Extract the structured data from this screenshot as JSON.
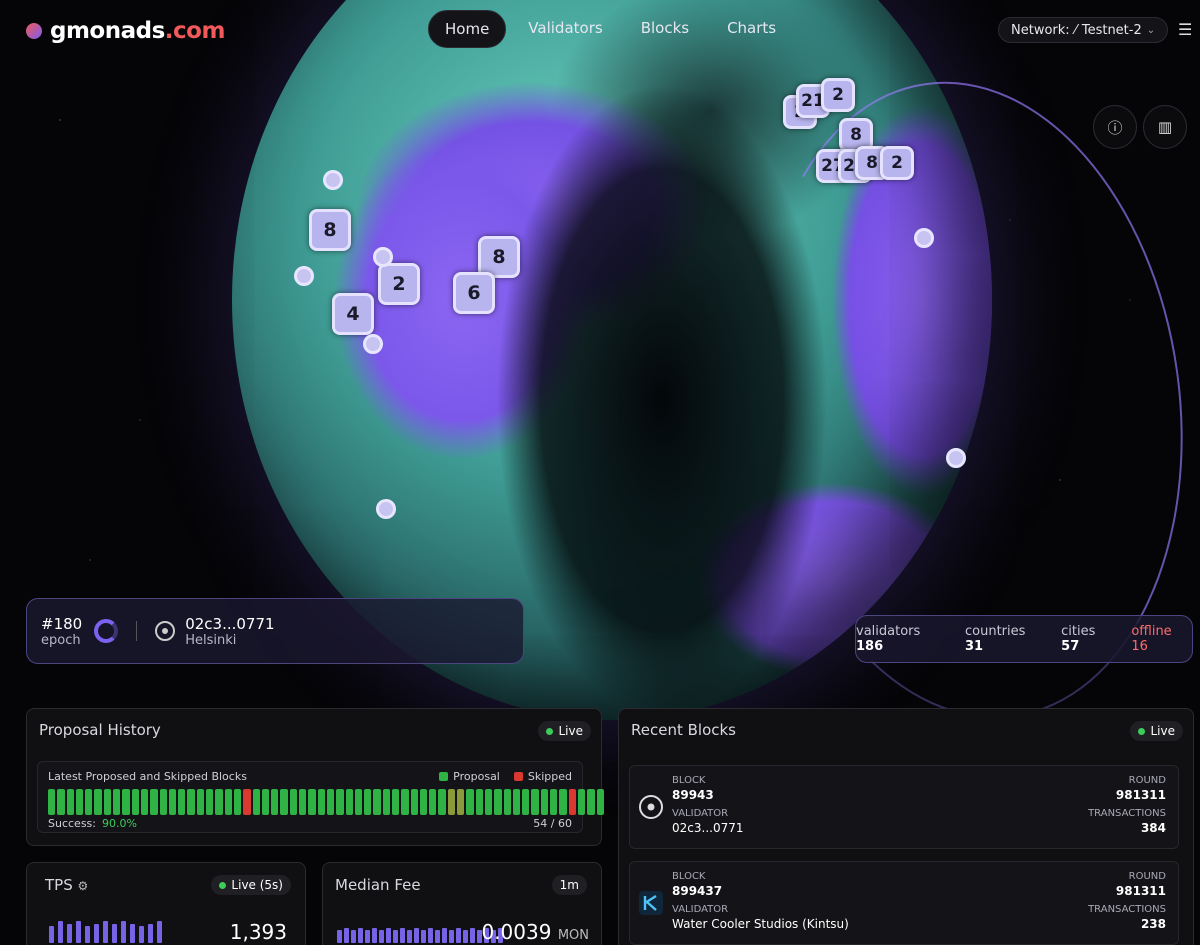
{
  "brand": {
    "name": "gmonads",
    "tld": ".com"
  },
  "nav": [
    "Home",
    "Validators",
    "Blocks",
    "Charts"
  ],
  "network": {
    "label": "Network:",
    "value": "Testnet-2"
  },
  "map_markers": [
    "2",
    "21",
    "2",
    "8",
    "27",
    "27",
    "8",
    "2",
    "8",
    "8",
    "2",
    "6",
    "4"
  ],
  "epoch": {
    "number": "#180",
    "label": "epoch",
    "validator": "02c3...0771",
    "city": "Helsinki"
  },
  "stats": {
    "validators_label": "validators",
    "validators": "186",
    "countries_label": "countries",
    "countries": "31",
    "cities_label": "cities",
    "cities": "57",
    "offline_label": "offline",
    "offline": "16"
  },
  "proposal_history": {
    "title": "Proposal History",
    "live": "Live",
    "subtitle": "Latest Proposed and Skipped Blocks",
    "legend_proposal": "Proposal",
    "legend_skipped": "Skipped",
    "success_label": "Success:",
    "success_value": "90.0%",
    "count": "54 / 60",
    "colors": {
      "proposal": "#2fb344",
      "skipped": "#d9392f",
      "partial": "#8a9a3a"
    },
    "blocks": [
      "P",
      "P",
      "P",
      "P",
      "P",
      "P",
      "P",
      "P",
      "P",
      "P",
      "P",
      "P",
      "P",
      "P",
      "P",
      "P",
      "P",
      "P",
      "P",
      "P",
      "P",
      "S",
      "P",
      "P",
      "P",
      "P",
      "P",
      "P",
      "P",
      "P",
      "P",
      "P",
      "P",
      "P",
      "P",
      "P",
      "P",
      "P",
      "P",
      "P",
      "P",
      "P",
      "P",
      "S",
      "S",
      "P",
      "P",
      "P",
      "P",
      "P",
      "P",
      "P",
      "P",
      "P",
      "P",
      "P",
      "S",
      "P",
      "P",
      "P"
    ]
  },
  "recent_blocks": {
    "title": "Recent Blocks",
    "live": "Live",
    "rows": [
      {
        "block_label": "BLOCK",
        "block": "89943",
        "validator_label": "VALIDATOR",
        "validator": "02c3...0771",
        "round_label": "ROUND",
        "round": "981311",
        "tx_label": "TRANSACTIONS",
        "tx": "384"
      },
      {
        "block_label": "BLOCK",
        "block": "899437",
        "validator_label": "VALIDATOR",
        "validator": "Water Cooler Studios (Kintsu)",
        "round_label": "ROUND",
        "round": "981311",
        "tx_label": "TRANSACTIONS",
        "tx": "238"
      }
    ]
  },
  "tps": {
    "title": "TPS",
    "live": "Live (5s)",
    "value": "1,393",
    "bars": [
      0.7,
      0.9,
      0.8,
      0.9,
      0.7,
      0.8,
      0.9,
      0.8,
      0.9,
      0.8,
      0.7,
      0.8,
      0.9
    ]
  },
  "median_fee": {
    "title": "Median Fee",
    "range": "1m",
    "value": "0.0039",
    "unit": "MON",
    "bars": [
      0.6,
      0.7,
      0.6,
      0.7,
      0.6,
      0.7,
      0.6,
      0.7,
      0.6,
      0.7,
      0.6,
      0.7,
      0.6,
      0.7,
      0.6,
      0.7,
      0.6,
      0.7,
      0.6,
      0.7,
      0.6,
      0.7,
      0.6,
      0.7
    ]
  }
}
